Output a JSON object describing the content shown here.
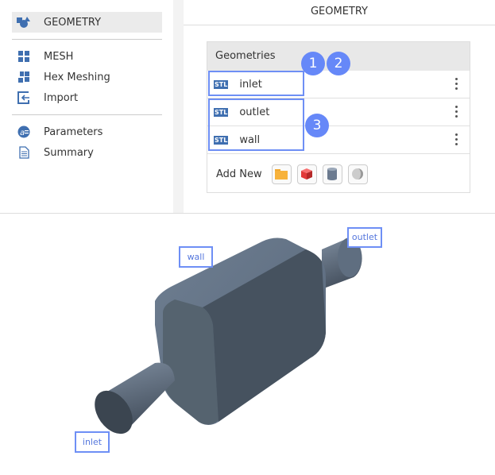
{
  "sidebar": {
    "items": [
      {
        "label": "GEOMETRY",
        "icon": "geometry-shapes-icon",
        "active": true
      },
      {
        "label": "MESH",
        "icon": "mesh-grid-icon"
      },
      {
        "label": "Hex Meshing",
        "icon": "hex-meshing-icon"
      },
      {
        "label": "Import",
        "icon": "import-icon"
      },
      {
        "label": "Parameters",
        "icon": "parameters-icon"
      },
      {
        "label": "Summary",
        "icon": "summary-document-icon"
      }
    ]
  },
  "main": {
    "title": "GEOMETRY",
    "card": {
      "header": "Geometries",
      "stl_tag": "STL",
      "items": [
        {
          "name": "inlet"
        },
        {
          "name": "outlet"
        },
        {
          "name": "wall"
        }
      ],
      "add_new": "Add New",
      "add_buttons": [
        "folder-icon",
        "cube-icon",
        "cylinder-icon",
        "sphere-icon"
      ]
    }
  },
  "badges": [
    "1",
    "2",
    "3"
  ],
  "viewport": {
    "labels": {
      "wall": "wall",
      "outlet": "outlet",
      "inlet": "inlet"
    }
  },
  "colors": {
    "accent": "#6688f8",
    "icon_blue": "#3f6fb0",
    "body": "#5a6a7c"
  }
}
